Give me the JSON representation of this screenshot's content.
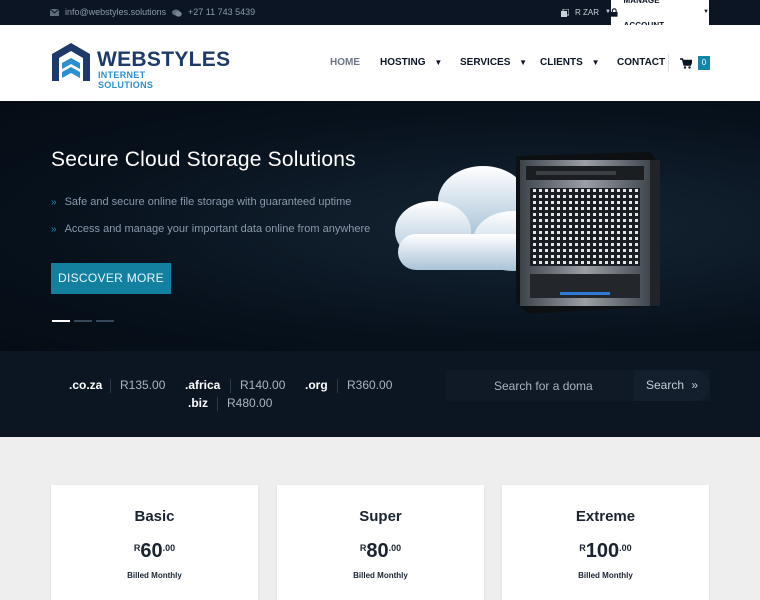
{
  "topbar": {
    "email": "info@webstyles.solutions",
    "phone": "+27 11 743 5439",
    "currency": "R ZAR",
    "account": "MANAGE ACCOUNT"
  },
  "header": {
    "logo_line1": "WEBSTYLES",
    "logo_line2": "INTERNET SOLUTIONS",
    "nav": {
      "home": "HOME",
      "hosting": "HOSTING",
      "services": "SERVICES",
      "clients": "CLIENTS",
      "contact": "CONTACT"
    },
    "cart_count": "0"
  },
  "hero": {
    "title": "Secure Cloud Storage Solutions",
    "bullets": [
      "Safe and secure online file storage with guaranteed uptime",
      "Access and manage your important data online from anywhere"
    ],
    "button": "DISCOVER MORE",
    "slides": 3,
    "active_slide": 0
  },
  "domains": {
    "tlds": [
      {
        "name": ".co.za",
        "price": "R135.00"
      },
      {
        "name": ".africa",
        "price": "R140.00"
      },
      {
        "name": ".org",
        "price": "R360.00"
      },
      {
        "name": ".biz",
        "price": "R480.00"
      }
    ],
    "search_placeholder": "Search for a doma",
    "search_button": "Search"
  },
  "plans": [
    {
      "name": "Basic",
      "currency": "R",
      "amount": "60",
      "cents": ".00",
      "billing": "Billed Monthly"
    },
    {
      "name": "Super",
      "currency": "R",
      "amount": "80",
      "cents": ".00",
      "billing": "Billed Monthly"
    },
    {
      "name": "Extreme",
      "currency": "R",
      "amount": "100",
      "cents": ".00",
      "billing": "Billed Monthly"
    }
  ],
  "colors": {
    "accent": "#14809f",
    "navy": "#0b1523",
    "brand": "#1d3a6b"
  }
}
